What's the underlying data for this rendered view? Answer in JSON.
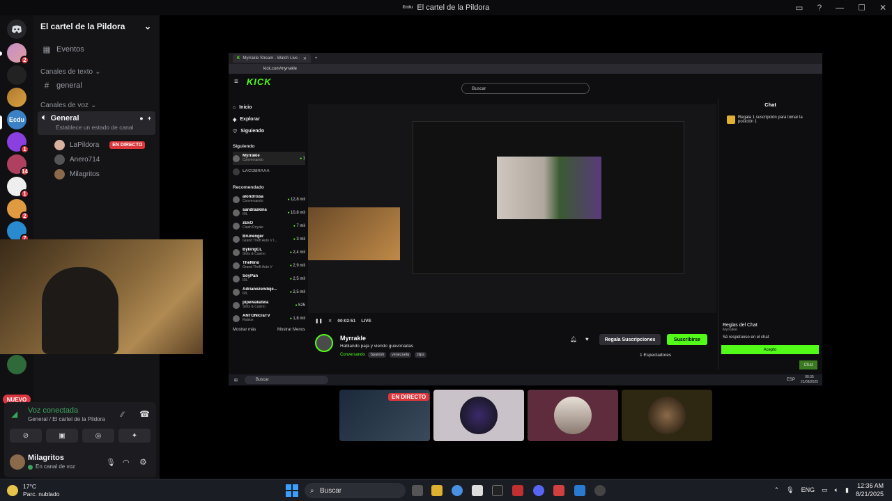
{
  "titlebar": {
    "logo": "Ecdu",
    "title": "El cartel de la Pildora"
  },
  "servers": {
    "badges": [
      "2",
      "1",
      "14",
      "1",
      "2",
      "7",
      "1"
    ],
    "nuevo": "NUEVO",
    "ecdu_label": "Ecdu"
  },
  "channels": {
    "guild_name": "El cartel de la Pildora",
    "events": "Eventos",
    "text_category": "Canales de texto",
    "text_channel": "general",
    "voice_category": "Canales de voz",
    "voice_channel": "General",
    "voice_status_placeholder": "Establece un estado de canal",
    "voice_users": [
      {
        "name": "LaPildora",
        "live": "EN DIRECTO"
      },
      {
        "name": "Anero714",
        "live": ""
      },
      {
        "name": "Milagritos",
        "live": ""
      }
    ]
  },
  "voice_panel": {
    "status": "Voz conectada",
    "channel": "General / El cartel de la Pildora",
    "user_name": "Milagritos",
    "user_status": "En canal de voz"
  },
  "browser": {
    "tab_title": "Myrrakle Stream - Watch Live ·",
    "url": "kick.com/myrrakle"
  },
  "kick": {
    "logo": "KICK",
    "search_placeholder": "Buscar",
    "nav": [
      "Inicio",
      "Explorar",
      "Siguiendo"
    ],
    "following_header": "Siguiendo",
    "following": [
      {
        "name": "Myrrakle",
        "sub": "Conversando",
        "viewers": "1"
      },
      {
        "name": "LACOBRAAA",
        "sub": "",
        "viewers": ""
      }
    ],
    "recommended_header": "Recomendado",
    "recommended": [
      {
        "name": "alondrissa",
        "sub": "Conversando",
        "viewers": "12,8 mil"
      },
      {
        "name": "sandraskins",
        "sub": "IRL",
        "viewers": "10,8 mil"
      },
      {
        "name": "zEkO",
        "sub": "Clash Royale",
        "viewers": "7 mil"
      },
      {
        "name": "Brunenger",
        "sub": "Grand Theft Auto V I...",
        "viewers": "3 mil"
      },
      {
        "name": "BykingCL",
        "sub": "Slots & Casino",
        "viewers": "2,4 mil"
      },
      {
        "name": "TheNino",
        "sub": "Grand Theft Auto V",
        "viewers": "2,9 mil"
      },
      {
        "name": "SoyPan",
        "sub": "IRL",
        "viewers": "2,5 mil"
      },
      {
        "name": "Adrianozendeje...",
        "sub": "IRL",
        "viewers": "2,5 mil"
      },
      {
        "name": "pipewakatela",
        "sub": "Slots & Casino",
        "viewers": "525"
      },
      {
        "name": "ANTONIcraTV",
        "sub": "Roblox",
        "viewers": "1,8 mil"
      }
    ],
    "show_more": "Mostrar más",
    "show_less": "Mostrar Menos",
    "player": {
      "time": "00:02:51",
      "live": "LIVE"
    },
    "streamer": {
      "name": "Myrrakle",
      "title": "Hablando paja y viendo guevonadas",
      "category": "Conversando",
      "tags": [
        "Spanish",
        "venezuela",
        "clips"
      ],
      "gift_button": "Regala Suscripciones",
      "subscribe_button": "Suscribirse",
      "spectators": "1 Espectadores"
    },
    "chat": {
      "title": "Chat",
      "promo": "Regala 1 suscripción para tomar la posición 1",
      "rules_title": "Reglas del Chat",
      "rules_by": "Myrrakle",
      "rules_text": "Sé respetuoso en el chat",
      "accept": "Acepto",
      "chat_button": "Chat"
    },
    "inner_taskbar_search": "Buscar",
    "inner_clock": "00:35",
    "inner_date": "21/08/2025",
    "inner_lang": "ESP"
  },
  "participants": {
    "live_badge": "EN DIRECTO"
  },
  "taskbar": {
    "temp": "17°C",
    "weather": "Parc. nublado",
    "search": "Buscar",
    "lang": "ENG",
    "time": "12:36 AM",
    "date": "8/21/2025"
  },
  "colors": {
    "kick_green": "#53fc18",
    "discord_live": "#da373c",
    "voice_green": "#3aa55d"
  }
}
